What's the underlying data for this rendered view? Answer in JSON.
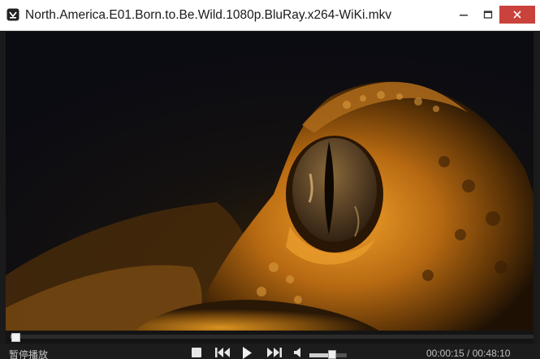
{
  "window": {
    "title": "North.America.E01.Born.to.Be.Wild.1080p.BluRay.x264-WiKi.mkv",
    "close_color": "#c9423b"
  },
  "icons": {
    "app": "media-player-icon",
    "minimize": "minimize-icon",
    "maximize": "maximize-icon",
    "close": "close-icon",
    "stop": "stop-icon",
    "previous": "skip-previous-icon",
    "play": "play-icon",
    "next": "skip-next-icon",
    "volume": "volume-icon"
  },
  "video": {
    "scene": "crocodile-eye-closeup"
  },
  "playback": {
    "status": "暂停播放",
    "time_current": "00:00:15",
    "time_total": "00:48:10",
    "time_display": "00:00:15 / 00:48:10",
    "progress_fraction": 0.005,
    "volume_fraction": 0.6
  }
}
